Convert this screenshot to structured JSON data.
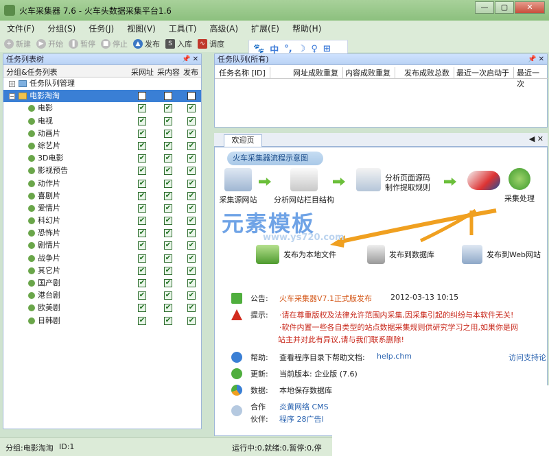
{
  "window": {
    "title": "火车采集器 7.6 - 火车头数据采集平台1.6",
    "controls": [
      "—",
      "▢",
      "✕"
    ]
  },
  "menu": [
    "文件(F)",
    "分组(S)",
    "任务(J)",
    "视图(V)",
    "工具(T)",
    "高级(A)",
    "扩展(E)",
    "帮助(H)"
  ],
  "toolbar": [
    {
      "label": "新建",
      "icon": "new-icon",
      "enabled": false
    },
    {
      "label": "开始",
      "icon": "play-icon",
      "enabled": false
    },
    {
      "label": "暂停",
      "icon": "pause-icon",
      "enabled": false
    },
    {
      "label": "停止",
      "icon": "stop-icon",
      "enabled": false
    },
    {
      "label": "发布",
      "icon": "publish-icon",
      "enabled": true
    },
    {
      "label": "入库",
      "icon": "sql-icon",
      "enabled": true
    },
    {
      "label": "调度",
      "icon": "schedule-icon",
      "enabled": true
    }
  ],
  "ime": {
    "symbols": [
      "🐾",
      "中",
      "°,",
      "☽",
      "♀",
      "⊞"
    ]
  },
  "left": {
    "title": "任务列表树",
    "col_name": "分组&任务列表",
    "col_a": "采网址",
    "col_b": "采内容",
    "col_c": "发布",
    "root1": "任务队列管理",
    "group": "电影淘淘",
    "items": [
      "电影",
      "电视",
      "动画片",
      "综艺片",
      "3D电影",
      "影视预告",
      "动作片",
      "喜剧片",
      "爱情片",
      "科幻片",
      "恐怖片",
      "剧情片",
      "战争片",
      "其它片",
      "国产剧",
      "港台剧",
      "欧美剧",
      "日韩剧"
    ]
  },
  "queue": {
    "title": "任务队列(所有)",
    "columns": [
      "任务名称 [ID]",
      "网址成败重复",
      "内容成败重复",
      "发布成败总数",
      "最近一次启动于",
      "最近一次"
    ]
  },
  "welcome": {
    "tab": "欢迎页",
    "flow_title": "火车采集器流程示意图",
    "nodes": [
      "采集源网站",
      "分析网站栏目结构",
      "分析页面源码\n制作提取规则",
      "采集处理"
    ],
    "outputs": [
      "发布为本地文件",
      "发布到数据库",
      "发布到Web网站"
    ],
    "watermark": "元素模板",
    "watermark_url": "www.ys720.com",
    "notice_label": "公告:",
    "notice_title": "火车采集器V7.1正式版发布",
    "notice_date": "2012-03-13 10:15",
    "tip_label": "提示:",
    "tip_line1": "·请在尊重版权及法律允许范围内采集,因采集引起的纠纷与本软件无关!",
    "tip_line2": "·软件内置一些各自类型的站点数据采集规则供研究学习之用,如果你是网",
    "tip_line3": "站主并对此有异议,请与我们联系删除!",
    "help_label": "帮助:",
    "help_text": "查看程序目录下帮助文档:",
    "help_file": "help.chm",
    "help_link": "访问支持论",
    "update_label": "更新:",
    "update_text": "当前版本: 企业版 (7.6)",
    "data_label": "数据:",
    "data_text": "本地保存数据库",
    "partner_label1": "合作",
    "partner_label2": "伙伴:",
    "partner_line1": "炎黄网络  CMS",
    "partner_line2": "程序  28广告l"
  },
  "status": {
    "group": "分组:电影淘淘",
    "id": "ID:1",
    "run": "运行中:0,就绪:0,暂停:0,停"
  }
}
